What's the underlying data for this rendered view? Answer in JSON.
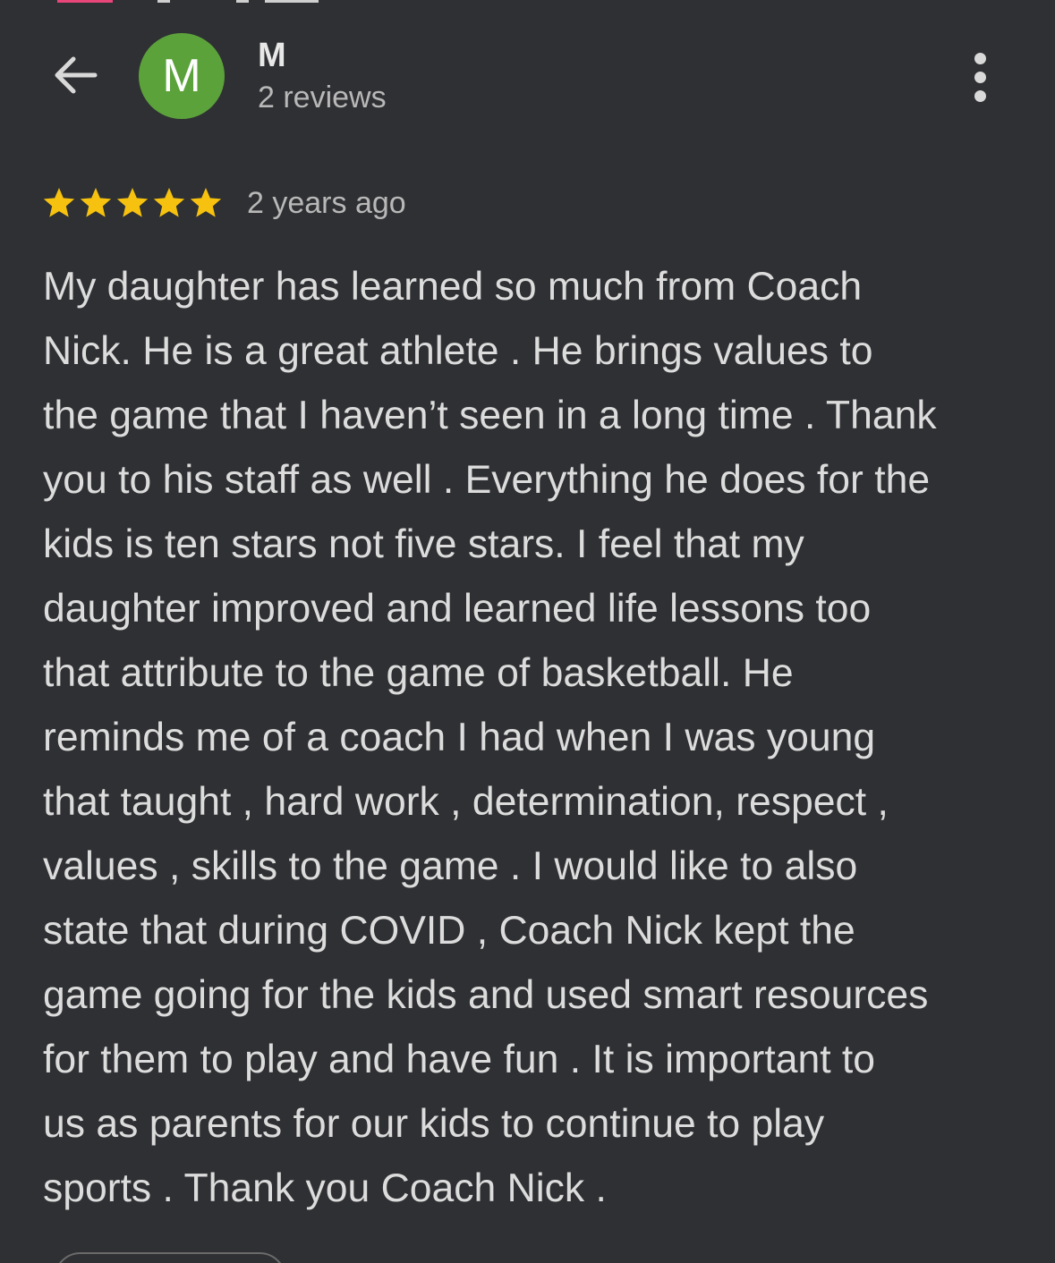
{
  "colors": {
    "background": "#2f3033",
    "avatar_bg": "#5ca23b",
    "star": "#f6c20f",
    "text_primary": "#dcdcdc",
    "text_secondary": "#b8b8b8"
  },
  "header": {
    "back_icon": "arrow-left-icon",
    "avatar_letter": "M",
    "reviewer_name": "M",
    "review_count": "2 reviews",
    "more_icon": "more-vertical-icon"
  },
  "review": {
    "rating": 5,
    "rating_max": 5,
    "time_ago": "2 years ago",
    "text": "My daughter has learned so much from Coach\nNick. He is a great athlete . He brings values to\nthe game that I haven’t seen in a long time . Thank\nyou to his staff as well . Everything he does for the\nkids is ten stars not five stars. I feel that my\ndaughter improved and learned life lessons too\nthat attribute to the game of basketball. He\nreminds me of a coach I had when I was young\nthat taught , hard work , determination, respect ,\nvalues , skills to the game . I would like to also\nstate that during COVID , Coach Nick kept the\ngame going for the kids and used smart resources\nfor them to play and have fun . It is important to\nus as parents for our kids to continue to play\nsports . Thank you Coach Nick ."
  }
}
